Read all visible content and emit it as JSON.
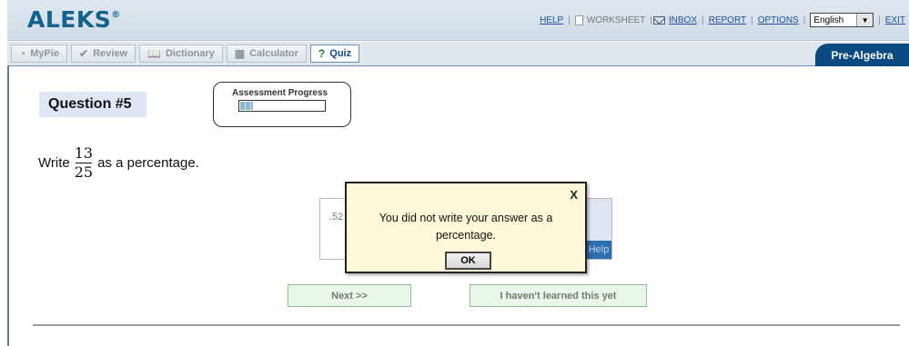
{
  "header": {
    "logo": "ALEKS",
    "logo_reg": "®",
    "links": {
      "help": "HELP",
      "worksheet": "WORKSHEET",
      "inbox": "INBOX",
      "report": "REPORT",
      "options": "OPTIONS",
      "exit": "EXIT"
    },
    "language": "English"
  },
  "tabs": [
    {
      "label": "MyPie",
      "icon": "pie-icon"
    },
    {
      "label": "Review",
      "icon": "check-icon"
    },
    {
      "label": "Dictionary",
      "icon": "book-icon"
    },
    {
      "label": "Calculator",
      "icon": "calculator-icon"
    },
    {
      "label": "Quiz",
      "icon": "quiz-icon"
    }
  ],
  "course": "Pre-Algebra",
  "question": {
    "label": "Question #5",
    "progress_label": "Assessment Progress",
    "progress_fraction": 0.15,
    "prompt_before": "Write",
    "fraction_num": "13",
    "fraction_den": "25",
    "prompt_after": "as a percentage.",
    "answer_value": ".52",
    "help_label": "Help"
  },
  "popup": {
    "close": "X",
    "message": "You did not write your answer as a percentage.",
    "ok": "OK"
  },
  "buttons": {
    "next": "Next >>",
    "not_learned": "I haven't learned this yet"
  }
}
